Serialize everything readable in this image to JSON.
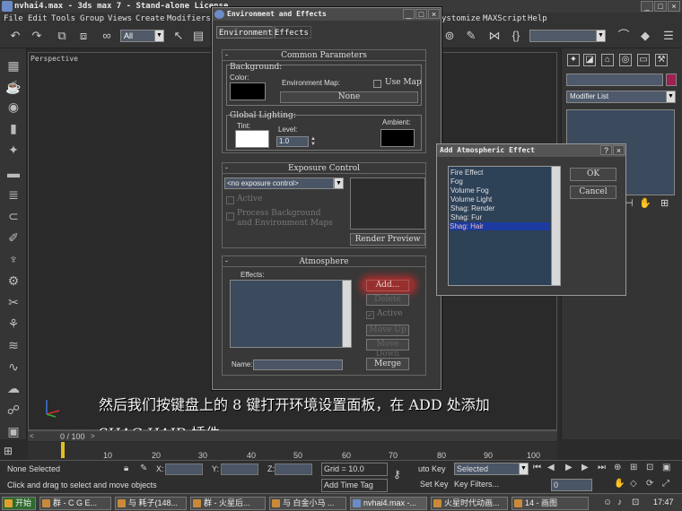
{
  "app": {
    "title": "nvhai4.max - 3ds max 7 - Stand-alone License"
  },
  "menu": [
    "File",
    "Edit",
    "Tools",
    "Group",
    "Views",
    "Create",
    "Modifiers",
    "ystomize",
    "MAXScript",
    "Help"
  ],
  "toolbar": {
    "selection_filter": "All"
  },
  "viewport": {
    "label": "Perspective"
  },
  "command_panel": {
    "modifier_list": "Modifier List"
  },
  "env_dialog": {
    "title": "Environment and Effects",
    "tabs": [
      "Environment",
      "Effects"
    ],
    "common": {
      "header": "Common Parameters",
      "background": "Background:",
      "color": "Color:",
      "env_map": "Environment Map:",
      "use_map": "Use Map",
      "none": "None",
      "global_lighting": "Global Lighting:",
      "tint": "Tint:",
      "level": "Level:",
      "level_value": "1.0",
      "ambient": "Ambient:"
    },
    "exposure": {
      "header": "Exposure Control",
      "select": "<no exposure control>",
      "active": "Active",
      "process": "Process Background",
      "process2": "and Environment Maps",
      "render_preview": "Render Preview"
    },
    "atmosphere": {
      "header": "Atmosphere",
      "effects": "Effects:",
      "add": "Add...",
      "delete": "Delete",
      "active": "Active",
      "move_up": "Move Up",
      "move_down": "Move Down",
      "name": "Name:",
      "merge": "Merge"
    }
  },
  "add_dialog": {
    "title": "Add Atmospheric Effect",
    "items": [
      "Fire Effect",
      "Fog",
      "Volume Fog",
      "Volume Light",
      "Shag: Render",
      "Shag: Fur",
      "Shag: Hair"
    ],
    "ok": "OK",
    "cancel": "Cancel"
  },
  "caption": {
    "line1": "然后我们按键盘上的 8 键打开环境设置面板，在 ADD 处添加",
    "line2": "SHAG HAIR 插件"
  },
  "timeline": {
    "position": "0 / 100",
    "ticks": [
      "10",
      "20",
      "30",
      "40",
      "50",
      "60",
      "70",
      "80",
      "90",
      "100"
    ]
  },
  "status": {
    "selected": "None Selected",
    "prompt": "Click and drag to select and move objects",
    "x": "X:",
    "y": "Y:",
    "z": "Z:",
    "grid": "Grid = 10.0",
    "add_time_tag": "Add Time Tag",
    "auto_key": "uto Key",
    "selected_dd": "Selected",
    "set_key": "Set Key",
    "key_filters": "Key Filters...",
    "frame": "0"
  },
  "taskbar": {
    "start": "开始",
    "tasks": [
      "群 - C G E...",
      "与 耗子(148...",
      "群 - 火星后...",
      "与 白金小马 ...",
      "nvhai4.max -...",
      "火星时代动画...",
      "14 - 画图"
    ],
    "clock": "17:47"
  }
}
